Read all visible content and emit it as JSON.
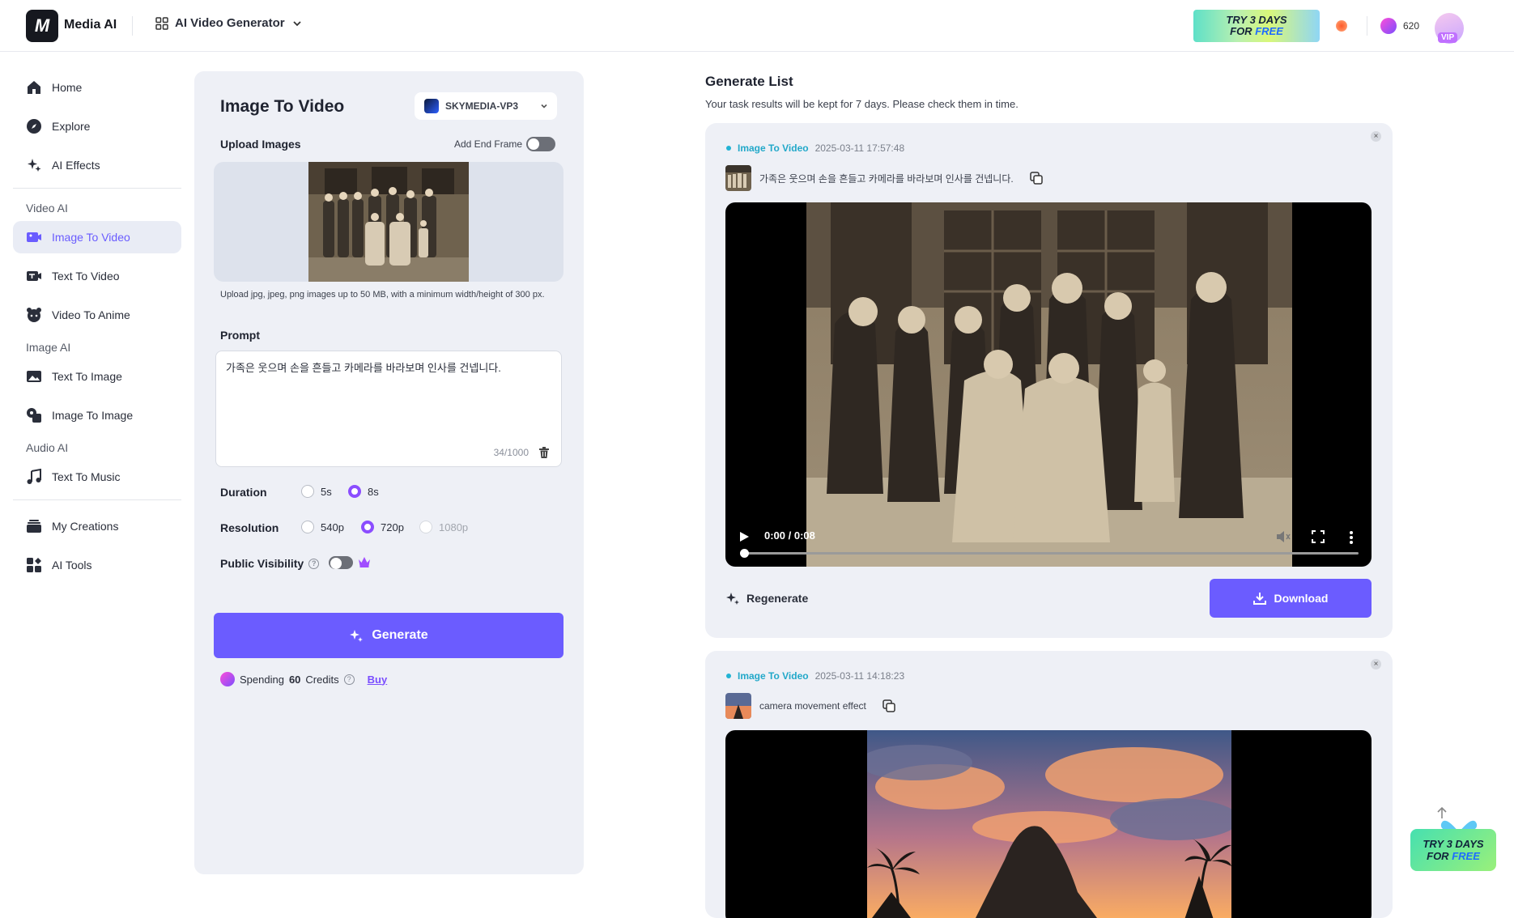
{
  "app": {
    "name": "Media AI",
    "logo_letter": "M"
  },
  "header": {
    "tool_switcher": "AI Video Generator",
    "promo": {
      "line1": "TRY 3 DAYS",
      "line2a": "FOR ",
      "line2b": "FREE"
    },
    "credits": "620",
    "vip": "VIP"
  },
  "sidebar": {
    "home": "Home",
    "explore": "Explore",
    "effects": "AI Effects",
    "video_section": "Video AI",
    "image_to_video": "Image To Video",
    "text_to_video": "Text To Video",
    "video_to_anime": "Video To Anime",
    "image_section": "Image AI",
    "text_to_image": "Text To Image",
    "image_to_image": "Image To Image",
    "audio_section": "Audio AI",
    "text_to_music": "Text To Music",
    "creations": "My Creations",
    "tools": "AI Tools"
  },
  "panel": {
    "title": "Image To Video",
    "model": "SKYMEDIA-VP3",
    "upload_label": "Upload Images",
    "end_frame": "Add End Frame",
    "hint": "Upload jpg, jpeg, png images up to 50 MB, with a minimum width/height of 300 px.",
    "prompt_label": "Prompt",
    "prompt_value": "가족은 웃으며 손을 흔들고 카메라를 바라보며 인사를 건넵니다.",
    "counter": "34/1000",
    "duration_label": "Duration",
    "duration_opts": [
      "5s",
      "8s"
    ],
    "duration_selected": "8s",
    "resolution_label": "Resolution",
    "resolution_opts": [
      "540p",
      "720p",
      "1080p"
    ],
    "resolution_selected": "720p",
    "visibility_label": "Public Visibility",
    "generate": "Generate",
    "spend_pre": "Spending",
    "spend_num": "60",
    "spend_post": "Credits",
    "buy": "Buy"
  },
  "list": {
    "title": "Generate List",
    "subtitle": "Your task results will be kept for 7 days. Please check them in time.",
    "cards": [
      {
        "tag": "Image To Video",
        "time": "2025-03-11 17:57:48",
        "prompt": "가족은 웃으며 손을 흔들고 카메라를 바라보며 인사를 건넵니다.",
        "video_time": "0:00 / 0:08",
        "regenerate": "Regenerate",
        "download": "Download"
      },
      {
        "tag": "Image To Video",
        "time": "2025-03-11 14:18:23",
        "prompt": "camera movement effect"
      }
    ]
  },
  "float_promo": {
    "line1": "TRY 3 DAYS",
    "line2a": "FOR ",
    "line2b": "FREE"
  }
}
